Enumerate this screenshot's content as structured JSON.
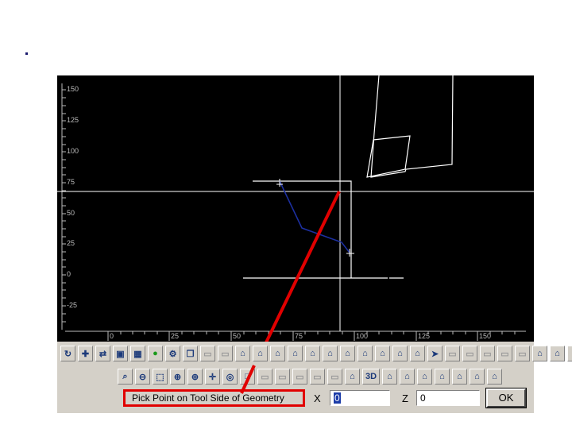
{
  "slide": {
    "bullet": "·"
  },
  "viewport": {
    "y_ticks": [
      "150",
      "125",
      "100",
      "75",
      "50",
      "25",
      "0",
      "-25"
    ],
    "x_ticks": [
      "0",
      "25",
      "50",
      "75",
      "100",
      "125",
      "150"
    ],
    "colors": {
      "background": "#000000",
      "geometry": "#ffffff",
      "toolpath": "#1c2fa0",
      "callout": "#e10000"
    }
  },
  "toolbar_top": {
    "icons": [
      "rotate-icon",
      "add-icon",
      "arrows-icon",
      "save-icon",
      "select-icon",
      "green-icon",
      "gear-icon",
      "copy-icon",
      "disabled-icon",
      "disabled-icon",
      "tool-icon",
      "tool-icon",
      "tool-icon",
      "tool-icon",
      "tool-icon",
      "tool-icon",
      "tool-icon",
      "tool-icon",
      "tool-icon",
      "tool-icon",
      "tool-icon",
      "arrow-icon",
      "disabled-icon",
      "disabled-icon",
      "disabled-icon",
      "disabled-icon",
      "disabled-icon",
      "tool-icon",
      "tool-icon",
      "tool-icon"
    ]
  },
  "toolbar_bottom": {
    "icons": [
      "zoom-icon",
      "zoom-out-icon",
      "zoom-window-icon",
      "zoom-fit-icon",
      "zoom-in-icon",
      "pan-icon",
      "zoom-all-icon",
      "frame-icon",
      "disabled-icon",
      "disabled-icon",
      "disabled-icon",
      "disabled-icon",
      "disabled-icon",
      "tool-icon",
      "tool-icon",
      "tool-icon",
      "tool-icon",
      "tool-icon",
      "tool-icon",
      "tool-icon",
      "tool-icon"
    ],
    "label_3d": "3D"
  },
  "status_bar": {
    "prompt": "Pick Point on Tool Side of Geometry",
    "x_label": "X",
    "x_value": "0",
    "z_label": "Z",
    "z_value": "0",
    "ok_label": "OK"
  }
}
